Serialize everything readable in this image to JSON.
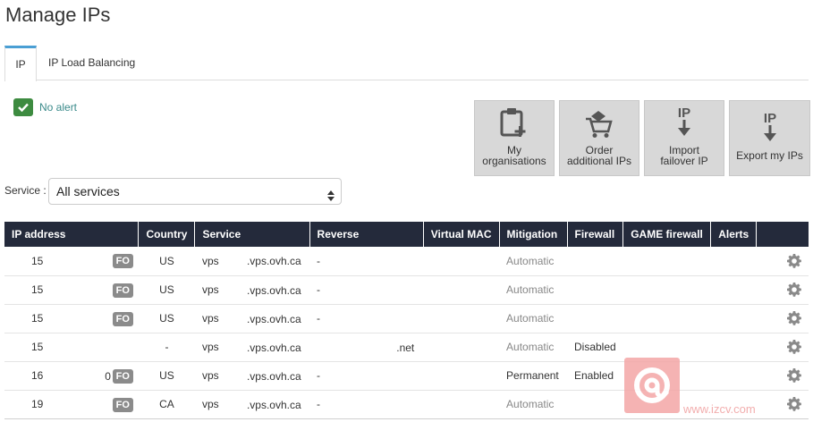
{
  "page": {
    "title": "Manage IPs"
  },
  "tabs": [
    {
      "label": "IP",
      "active": true
    },
    {
      "label": "IP Load Balancing",
      "active": false
    }
  ],
  "alert": {
    "label": "No alert",
    "color": "#3d8b40"
  },
  "actions": [
    {
      "label1": "My",
      "label2": "organisations",
      "icon": "clipboard-plus-icon"
    },
    {
      "label1": "Order",
      "label2": "additional IPs",
      "icon": "cart-icon"
    },
    {
      "label1": "Import",
      "label2": "failover IP",
      "icon": "ip-import-icon"
    },
    {
      "label1": "Export my IPs",
      "label2": "",
      "icon": "ip-export-icon"
    }
  ],
  "filter": {
    "label": "Service :",
    "value": "All services"
  },
  "table": {
    "headers": [
      "IP address",
      "Country",
      "Service",
      "Reverse",
      "Virtual MAC",
      "Mitigation",
      "Firewall",
      "GAME firewall",
      "Alerts"
    ],
    "rows": [
      {
        "ip": "15",
        "prefix": "",
        "badge": "FO",
        "country": "US",
        "service": "vps",
        "service_host": ".vps.ovh.ca",
        "reverse": "-",
        "vmac": "",
        "mitigation": "Automatic",
        "firewall": "",
        "game": "",
        "alerts": ""
      },
      {
        "ip": "15",
        "prefix": "",
        "badge": "FO",
        "country": "US",
        "service": "vps",
        "service_host": ".vps.ovh.ca",
        "reverse": "-",
        "vmac": "",
        "mitigation": "Automatic",
        "firewall": "",
        "game": "",
        "alerts": ""
      },
      {
        "ip": "15",
        "prefix": "",
        "badge": "FO",
        "country": "US",
        "service": "vps",
        "service_host": ".vps.ovh.ca",
        "reverse": "-",
        "vmac": "",
        "mitigation": "Automatic",
        "firewall": "",
        "game": "",
        "alerts": ""
      },
      {
        "ip": "15",
        "prefix": "",
        "badge": "",
        "country": "-",
        "service": "vps",
        "service_host": ".vps.ovh.ca",
        "reverse": "",
        "vmac": ".net",
        "mitigation": "Automatic",
        "firewall": "Disabled",
        "game": "",
        "alerts": ""
      },
      {
        "ip": "16",
        "prefix": "0",
        "badge": "FO",
        "country": "US",
        "service": "vps",
        "service_host": ".vps.ovh.ca",
        "reverse": "-",
        "vmac": "",
        "mitigation": "Permanent",
        "firewall": "Enabled",
        "game": "",
        "alerts": ""
      },
      {
        "ip": "19",
        "prefix": "",
        "badge": "FO",
        "country": "CA",
        "service": "vps",
        "service_host": ".vps.ovh.ca",
        "reverse": "-",
        "vmac": "",
        "mitigation": "Automatic",
        "firewall": "",
        "game": "",
        "alerts": ""
      }
    ]
  },
  "watermark": {
    "url": "www.izcv.com"
  }
}
